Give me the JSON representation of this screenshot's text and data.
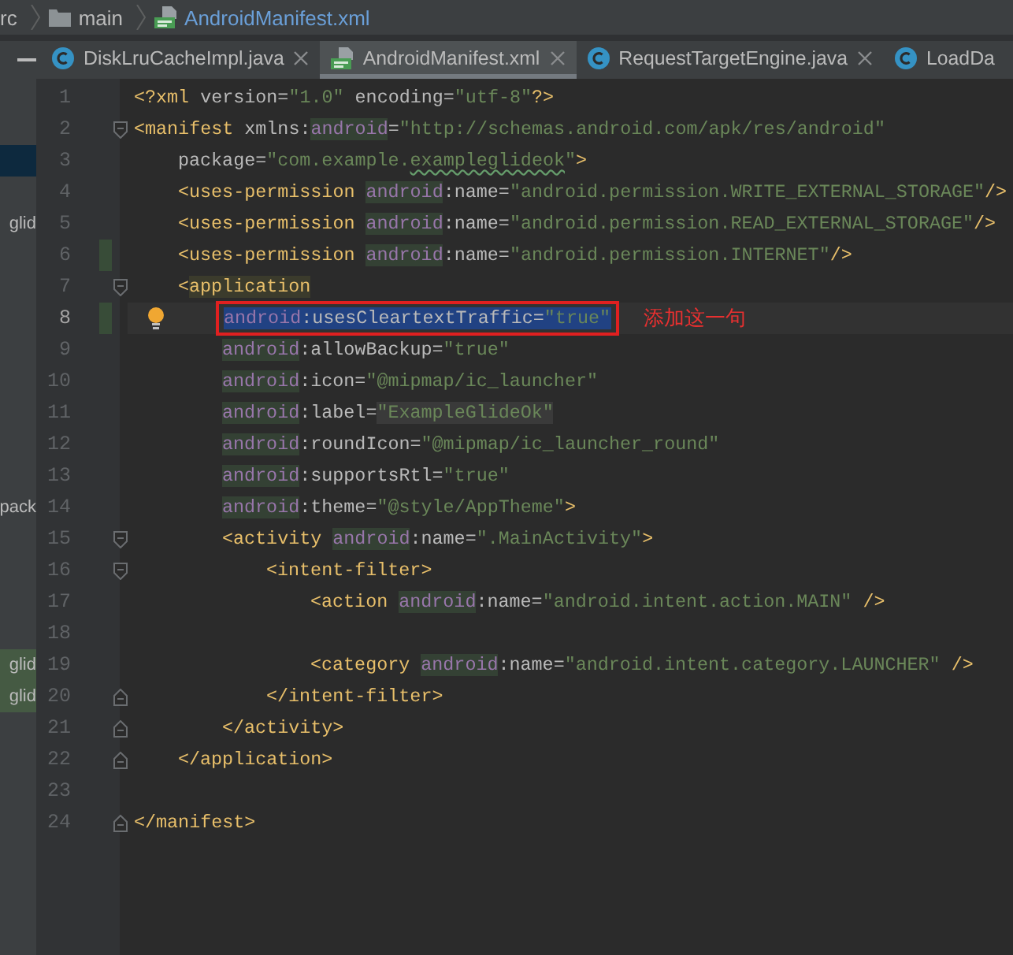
{
  "breadcrumb": [
    {
      "label": "rc",
      "kind": "plain",
      "current": false
    },
    {
      "label": "main",
      "kind": "folder",
      "current": false
    },
    {
      "label": "AndroidManifest.xml",
      "kind": "manifest",
      "current": true
    }
  ],
  "project_panel": {
    "rows": [
      {
        "selected": false,
        "modified": false
      },
      {
        "selected": false,
        "modified": false
      },
      {
        "selected": true,
        "modified": false
      },
      {
        "selected": false,
        "modified": false
      },
      {
        "selected": false,
        "modified": false,
        "text": "glid"
      },
      {
        "selected": false,
        "modified": false
      },
      {
        "selected": false,
        "modified": false
      },
      {
        "selected": false,
        "modified": false
      },
      {
        "selected": false,
        "modified": false
      },
      {
        "selected": false,
        "modified": false
      },
      {
        "selected": false,
        "modified": false
      },
      {
        "selected": false,
        "modified": false
      },
      {
        "selected": false,
        "modified": false
      },
      {
        "selected": false,
        "modified": false,
        "text": "pack"
      },
      {
        "selected": false,
        "modified": false
      },
      {
        "selected": false,
        "modified": false
      },
      {
        "selected": false,
        "modified": false
      },
      {
        "selected": false,
        "modified": false
      },
      {
        "selected": false,
        "modified": true,
        "text": "glid"
      },
      {
        "selected": false,
        "modified": true,
        "text": "glid"
      },
      {
        "selected": false,
        "modified": false
      },
      {
        "selected": false,
        "modified": false
      },
      {
        "selected": false,
        "modified": false
      },
      {
        "selected": false,
        "modified": false
      }
    ]
  },
  "tabs": [
    {
      "label": "DiskLruCacheImpl.java",
      "kind": "class",
      "selected": false,
      "closable": true
    },
    {
      "label": "AndroidManifest.xml",
      "kind": "manifest",
      "selected": true,
      "closable": true
    },
    {
      "label": "RequestTargetEngine.java",
      "kind": "class",
      "selected": false,
      "closable": true
    },
    {
      "label": "LoadDa",
      "kind": "class",
      "selected": false,
      "closable": false
    }
  ],
  "editor": {
    "lines": [
      {
        "number": "1",
        "changed": false,
        "current": false,
        "selected": false,
        "bulb": false,
        "fold_start": false,
        "fold_end": false,
        "segments": [
          {
            "kind": "tag",
            "text": "<?xml"
          },
          {
            "kind": "attr",
            "text": " version="
          },
          {
            "kind": "value",
            "text": "\"1.0\""
          },
          {
            "kind": "attr",
            "text": " encoding="
          },
          {
            "kind": "value",
            "text": "\"utf-8\""
          },
          {
            "kind": "tag",
            "text": "?>"
          }
        ]
      },
      {
        "number": "2",
        "changed": false,
        "current": false,
        "selected": false,
        "bulb": false,
        "fold_start": true,
        "fold_end": false,
        "segments": [
          {
            "kind": "tag",
            "text": "<manifest"
          },
          {
            "kind": "attr",
            "text": " xmlns:"
          },
          {
            "kind": "ns",
            "text": "android"
          },
          {
            "kind": "attr",
            "text": "="
          },
          {
            "kind": "value",
            "text": "\"http://schemas.android.com/apk/res/android\""
          }
        ],
        "children": [
          {
            "number": "3",
            "changed": false,
            "current": false,
            "selected": false,
            "bulb": false,
            "fold_start": false,
            "fold_end": false,
            "segments": [
              {
                "kind": "attr",
                "text": "package="
              },
              {
                "kind": "value",
                "text": "\"com.example."
              },
              {
                "kind": "typo",
                "text": "exampleglideok"
              },
              {
                "kind": "value",
                "text": "\""
              },
              {
                "kind": "tag",
                "text": ">"
              }
            ]
          },
          {
            "number": "4",
            "changed": false,
            "current": false,
            "selected": false,
            "bulb": false,
            "fold_start": false,
            "fold_end": false,
            "segments": [
              {
                "kind": "tag",
                "text": "<uses-permission "
              },
              {
                "kind": "ns",
                "text": "android"
              },
              {
                "kind": "attr",
                "text": ":name="
              },
              {
                "kind": "value",
                "text": "\"android.permission.WRITE_EXTERNAL_STORAGE\""
              },
              {
                "kind": "tag",
                "text": "/>"
              }
            ]
          },
          {
            "number": "5",
            "changed": false,
            "current": false,
            "selected": false,
            "bulb": false,
            "fold_start": false,
            "fold_end": false,
            "segments": [
              {
                "kind": "tag",
                "text": "<uses-permission "
              },
              {
                "kind": "ns",
                "text": "android"
              },
              {
                "kind": "attr",
                "text": ":name="
              },
              {
                "kind": "value",
                "text": "\"android.permission.READ_EXTERNAL_STORAGE\""
              },
              {
                "kind": "tag",
                "text": "/>"
              }
            ]
          },
          {
            "number": "6",
            "changed": true,
            "current": false,
            "selected": false,
            "bulb": false,
            "fold_start": false,
            "fold_end": false,
            "segments": [
              {
                "kind": "tag",
                "text": "<uses-permission "
              },
              {
                "kind": "ns",
                "text": "android"
              },
              {
                "kind": "attr",
                "text": ":name="
              },
              {
                "kind": "value",
                "text": "\"android.permission.INTERNET\""
              },
              {
                "kind": "tag",
                "text": "/>"
              }
            ]
          },
          {
            "number": "7",
            "changed": false,
            "current": false,
            "selected": false,
            "bulb": false,
            "fold_start": true,
            "fold_end": false,
            "segments": [
              {
                "kind": "tag",
                "text": "<"
              },
              {
                "kind": "tagmatch",
                "text": "application"
              }
            ],
            "children": [
              {
                "number": "8",
                "changed": true,
                "current": true,
                "selected": true,
                "bulb": true,
                "fold_start": false,
                "fold_end": false,
                "annotation": {
                  "text": "添加这一句"
                },
                "segments": [
                  {
                    "kind": "ns",
                    "text": "android"
                  },
                  {
                    "kind": "attr",
                    "text": ":usesCleartextTraffic="
                  },
                  {
                    "kind": "value",
                    "text": "\"true\""
                  }
                ]
              },
              {
                "number": "9",
                "changed": false,
                "current": false,
                "selected": false,
                "bulb": false,
                "fold_start": false,
                "fold_end": false,
                "segments": [
                  {
                    "kind": "ns",
                    "text": "android"
                  },
                  {
                    "kind": "attr",
                    "text": ":allowBackup="
                  },
                  {
                    "kind": "value",
                    "text": "\"true\""
                  }
                ]
              },
              {
                "number": "10",
                "changed": false,
                "current": false,
                "selected": false,
                "bulb": false,
                "fold_start": false,
                "fold_end": false,
                "segments": [
                  {
                    "kind": "ns",
                    "text": "android"
                  },
                  {
                    "kind": "attr",
                    "text": ":icon="
                  },
                  {
                    "kind": "value",
                    "text": "\"@mipmap/ic_launcher\""
                  }
                ]
              },
              {
                "number": "11",
                "changed": false,
                "current": false,
                "selected": false,
                "bulb": false,
                "fold_start": false,
                "fold_end": false,
                "segments": [
                  {
                    "kind": "ns",
                    "text": "android"
                  },
                  {
                    "kind": "attr",
                    "text": ":label="
                  },
                  {
                    "kind": "folded",
                    "text": "\"ExampleGlideOk\""
                  }
                ]
              },
              {
                "number": "12",
                "changed": false,
                "current": false,
                "selected": false,
                "bulb": false,
                "fold_start": false,
                "fold_end": false,
                "segments": [
                  {
                    "kind": "ns",
                    "text": "android"
                  },
                  {
                    "kind": "attr",
                    "text": ":roundIcon="
                  },
                  {
                    "kind": "value",
                    "text": "\"@mipmap/ic_launcher_round\""
                  }
                ]
              },
              {
                "number": "13",
                "changed": false,
                "current": false,
                "selected": false,
                "bulb": false,
                "fold_start": false,
                "fold_end": false,
                "segments": [
                  {
                    "kind": "ns",
                    "text": "android"
                  },
                  {
                    "kind": "attr",
                    "text": ":supportsRtl="
                  },
                  {
                    "kind": "value",
                    "text": "\"true\""
                  }
                ]
              },
              {
                "number": "14",
                "changed": false,
                "current": false,
                "selected": false,
                "bulb": false,
                "fold_start": false,
                "fold_end": false,
                "segments": [
                  {
                    "kind": "ns",
                    "text": "android"
                  },
                  {
                    "kind": "attr",
                    "text": ":theme="
                  },
                  {
                    "kind": "value",
                    "text": "\"@style/AppTheme\""
                  },
                  {
                    "kind": "tag",
                    "text": ">"
                  }
                ]
              },
              {
                "number": "15",
                "changed": false,
                "current": false,
                "selected": false,
                "bulb": false,
                "fold_start": true,
                "fold_end": false,
                "segments": [
                  {
                    "kind": "tag",
                    "text": "<activity "
                  },
                  {
                    "kind": "ns",
                    "text": "android"
                  },
                  {
                    "kind": "attr",
                    "text": ":name="
                  },
                  {
                    "kind": "value",
                    "text": "\".MainActivity\""
                  },
                  {
                    "kind": "tag",
                    "text": ">"
                  }
                ],
                "children": [
                  {
                    "number": "16",
                    "changed": false,
                    "current": false,
                    "selected": false,
                    "bulb": false,
                    "fold_start": true,
                    "fold_end": false,
                    "segments": [
                      {
                        "kind": "tag",
                        "text": "<intent-filter>"
                      }
                    ],
                    "children": [
                      {
                        "number": "17",
                        "changed": false,
                        "current": false,
                        "selected": false,
                        "bulb": false,
                        "fold_start": false,
                        "fold_end": false,
                        "segments": [
                          {
                            "kind": "tag",
                            "text": "<action "
                          },
                          {
                            "kind": "ns",
                            "text": "android"
                          },
                          {
                            "kind": "attr",
                            "text": ":name="
                          },
                          {
                            "kind": "value",
                            "text": "\"android.intent.action.MAIN\""
                          },
                          {
                            "kind": "tag",
                            "text": " />"
                          }
                        ]
                      },
                      {
                        "number": "18",
                        "changed": false,
                        "current": false,
                        "bulb": false,
                        "fold_start": false,
                        "fold_end": false
                      },
                      {
                        "number": "19",
                        "changed": false,
                        "current": false,
                        "selected": false,
                        "bulb": false,
                        "fold_start": false,
                        "fold_end": false,
                        "segments": [
                          {
                            "kind": "tag",
                            "text": "<category "
                          },
                          {
                            "kind": "ns",
                            "text": "android"
                          },
                          {
                            "kind": "attr",
                            "text": ":name="
                          },
                          {
                            "kind": "value",
                            "text": "\"android.intent.category.LAUNCHER\""
                          },
                          {
                            "kind": "tag",
                            "text": " />"
                          }
                        ]
                      }
                    ]
                  },
                  {
                    "number": "20",
                    "changed": false,
                    "current": false,
                    "selected": false,
                    "bulb": false,
                    "fold_start": false,
                    "fold_end": true,
                    "segments": [
                      {
                        "kind": "tag",
                        "text": "</intent-filter>"
                      }
                    ]
                  }
                ]
              },
              {
                "number": "21",
                "changed": false,
                "current": false,
                "selected": false,
                "bulb": false,
                "fold_start": false,
                "fold_end": true,
                "segments": [
                  {
                    "kind": "tag",
                    "text": "</activity>"
                  }
                ]
              }
            ]
          },
          {
            "number": "22",
            "changed": false,
            "current": false,
            "selected": false,
            "bulb": false,
            "fold_start": false,
            "fold_end": true,
            "segments": [
              {
                "kind": "tag",
                "text": "</application>"
              }
            ]
          }
        ]
      },
      {
        "number": "23",
        "changed": false,
        "current": false,
        "bulb": false,
        "fold_start": false,
        "fold_end": false
      },
      {
        "number": "24",
        "changed": false,
        "current": false,
        "selected": false,
        "bulb": false,
        "fold_start": false,
        "fold_end": true,
        "segments": [
          {
            "kind": "tag",
            "text": "</manifest>"
          }
        ]
      }
    ]
  }
}
